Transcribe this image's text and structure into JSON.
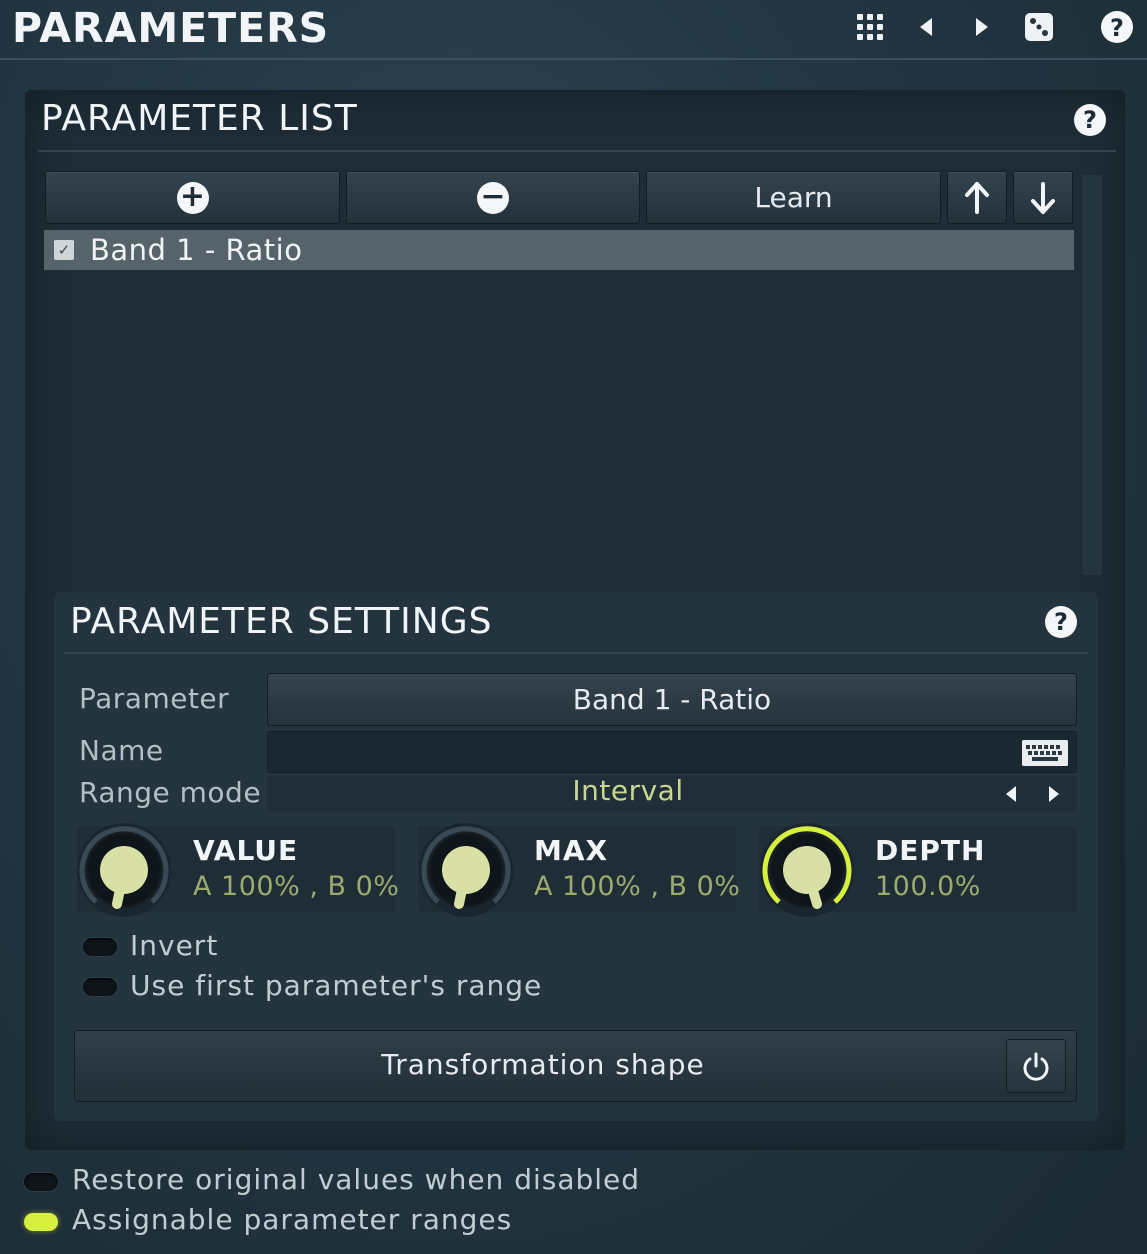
{
  "header": {
    "title": "PARAMETERS",
    "icons": [
      "grid-icon",
      "prev-icon",
      "next-icon",
      "dice-icon",
      "help-icon"
    ]
  },
  "parameter_list": {
    "title": "PARAMETER LIST",
    "help": "?",
    "toolbar": {
      "add_icon": "+",
      "remove_icon": "−",
      "learn_label": "Learn",
      "up_icon": "arrow-up-icon",
      "down_icon": "arrow-down-icon"
    },
    "items": [
      {
        "label": "Band 1 - Ratio",
        "checked": true
      }
    ]
  },
  "parameter_settings": {
    "title": "PARAMETER SETTINGS",
    "help": "?",
    "parameter_label": "Parameter",
    "parameter_value": "Band 1 - Ratio",
    "name_label": "Name",
    "name_value": "",
    "range_mode_label": "Range mode",
    "range_mode_value": "Interval",
    "knobs": [
      {
        "title": "VALUE",
        "value": "A 100% , B 0%"
      },
      {
        "title": "MAX",
        "value": "A 100% , B 0%"
      },
      {
        "title": "DEPTH",
        "value": "100.0%"
      }
    ],
    "invert_label": "Invert",
    "invert_on": false,
    "use_first_range_label": "Use first parameter's range",
    "use_first_range_on": false,
    "transformation_label": "Transformation shape"
  },
  "footer": {
    "restore_label": "Restore original values when disabled",
    "restore_on": false,
    "assignable_label": "Assignable parameter ranges",
    "assignable_on": true
  },
  "colors": {
    "accent": "#d7ef3e",
    "value_text": "#9aab6e",
    "background": "#233642"
  }
}
